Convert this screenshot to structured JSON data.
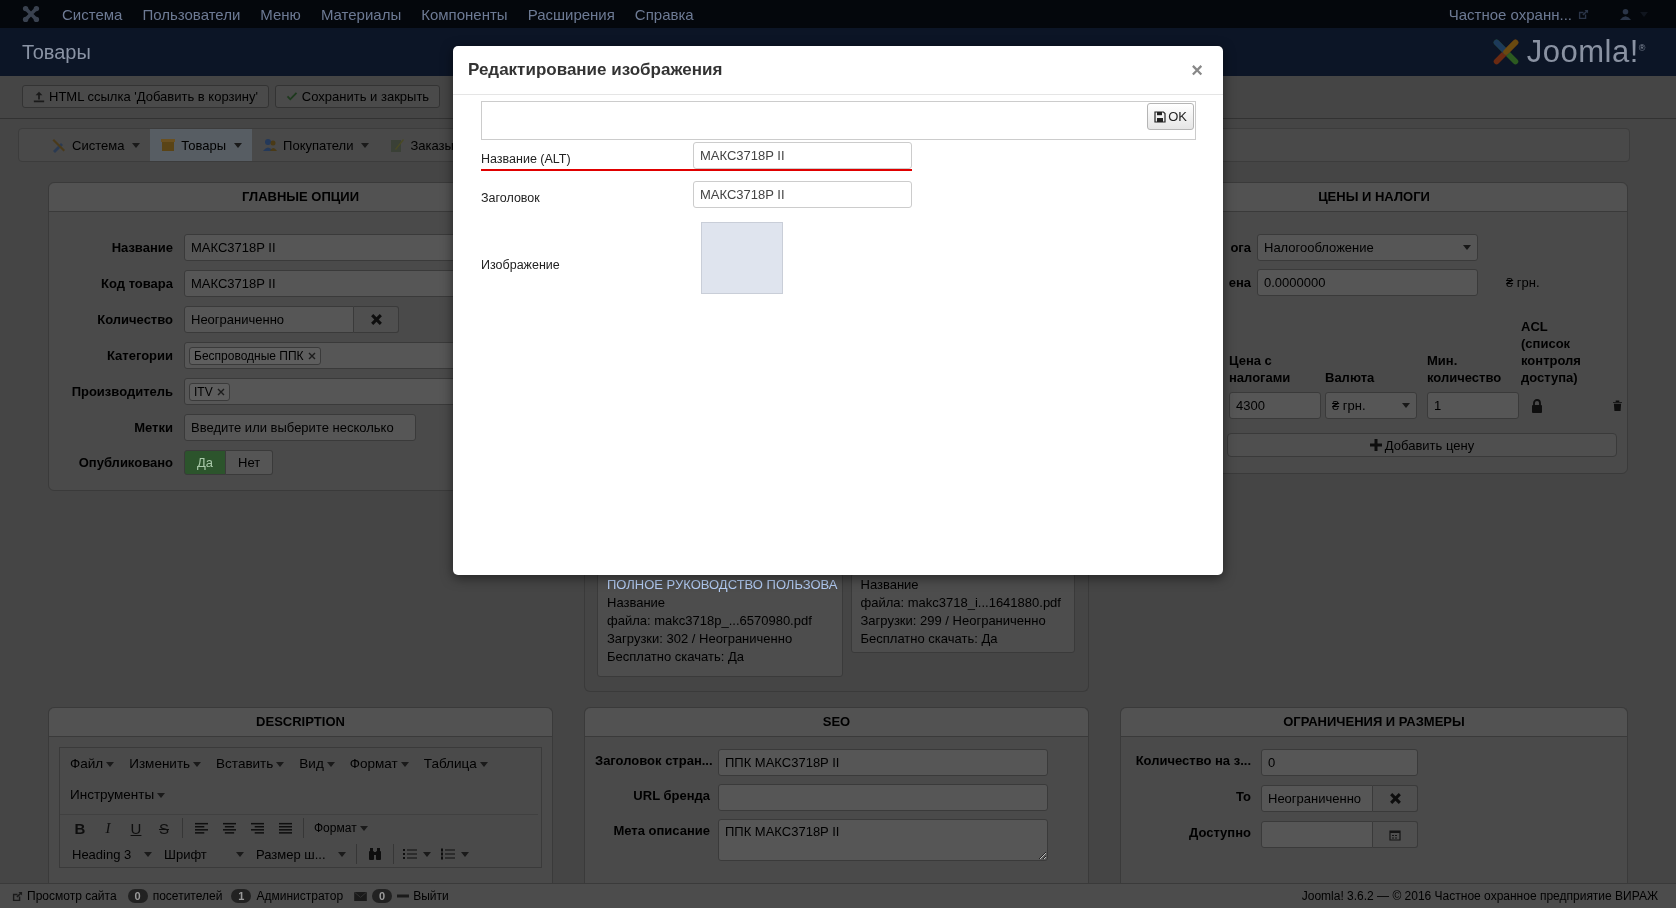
{
  "topbar": {
    "menu": [
      "Система",
      "Пользователи",
      "Меню",
      "Материалы",
      "Компоненты",
      "Расширения",
      "Справка"
    ],
    "site_link": "Частное охранн..."
  },
  "header": {
    "title": "Товары",
    "logo_text": "Joomla!$^{®}$"
  },
  "toolbar": {
    "buttons": [
      {
        "label": "HTML ссылка 'Добавить в корзину'"
      },
      {
        "label": "Сохранить и закрыть"
      }
    ]
  },
  "submenu": [
    {
      "label": "Система",
      "selected": false
    },
    {
      "label": "Товары",
      "selected": true
    },
    {
      "label": "Покупатели",
      "selected": false
    },
    {
      "label": "Заказы",
      "selected": false
    }
  ],
  "main_options": {
    "title": "ГЛАВНЫЕ ОПЦИИ",
    "fields": [
      {
        "label": "Название",
        "kind": "text",
        "value": "МАКС3718P II"
      },
      {
        "label": "Код товара",
        "kind": "text",
        "value": "МАКС3718P II"
      },
      {
        "label": "Количество",
        "kind": "clearable",
        "value": "Неограниченно"
      },
      {
        "label": "Категории",
        "kind": "tags",
        "tags": [
          "Беспроводные ППК"
        ]
      },
      {
        "label": "Производитель",
        "kind": "tags",
        "tags": [
          "ITV"
        ]
      },
      {
        "label": "Метки",
        "kind": "short",
        "placeholder": "Введите или выберите несколько"
      },
      {
        "label": "Опубликовано",
        "kind": "toggle",
        "options": [
          {
            "label": "Да",
            "selected": true
          },
          {
            "label": "Нет",
            "selected": false
          }
        ]
      }
    ]
  },
  "prices": {
    "title": "ЦЕНЫ И НАЛОГИ",
    "fields": [
      {
        "label": "ога",
        "kind": "select",
        "value": "Налогообложение"
      },
      {
        "label": "ена",
        "kind": "text",
        "value": "0.0000000",
        "suffix": "₴ грн."
      }
    ],
    "columns": [
      "Цена с налогами",
      "Валюта",
      "Мин. количество",
      "ACL (список контроля доступа)"
    ],
    "rows": [
      {
        "price": "4300",
        "currency": "₴ грн.",
        "min_qty": "1"
      }
    ],
    "add_button": "Добавить цену"
  },
  "files": [
    {
      "title": "ПОЛНОЕ РУКОВОДСТВО ПОЛЬЗОВА",
      "lines": [
        "Название",
        "файла: makc3718p_...6570980.pdf",
        "Загрузки: 302 / Неограниченно",
        "Бесплатно скачать: Да"
      ]
    },
    {
      "lines": [
        "Название",
        "файла: makc3718_i...1641880.pdf",
        "Загрузки: 299 / Неограниченно",
        "Бесплатно скачать: Да"
      ]
    }
  ],
  "description": {
    "title": "DESCRIPTION",
    "menus": [
      "Файл",
      "Изменить",
      "Вставить",
      "Вид",
      "Формат",
      "Таблица",
      "Инструменты"
    ],
    "format_buttons": [
      "B",
      "I",
      "U",
      "S"
    ],
    "format_menu": "Формат",
    "block_format": "Heading 3",
    "font": "Шрифт",
    "font_size": "Размер ш..."
  },
  "seo": {
    "title": "SEO",
    "fields": [
      {
        "label": "Заголовок стран...",
        "kind": "text",
        "value": "ППК МАКС3718P II"
      },
      {
        "label": "URL бренда",
        "kind": "text"
      },
      {
        "label": "Мета описание",
        "kind": "textarea",
        "value": "ППК МАКС3718P II"
      }
    ]
  },
  "limits": {
    "title": "ОГРАНИЧЕНИЯ И РАЗМЕРЫ",
    "fields": [
      {
        "label": "Количество на з...",
        "kind": "text",
        "value": "0"
      },
      {
        "label": "То",
        "kind": "clearable",
        "value": "Неограниченно"
      },
      {
        "label": "Доступно",
        "kind": "date"
      }
    ]
  },
  "status_bar": {
    "view_site": "Просмотр сайта",
    "visitors_count": "0",
    "visitors": "посетителей",
    "admins_count": "1",
    "admins": "Администратор",
    "messages_count": "0",
    "logout": "Выйти",
    "footer": "Joomla! 3.6.2 — © 2016 Частное охранное предприятие ВИРАЖ"
  },
  "modal": {
    "title": "Редактирование изображения",
    "close": "×",
    "ok": "OK",
    "fields": [
      {
        "label": "Название (ALT)",
        "kind": "text",
        "value": "МАКС3718P II",
        "highlighted": true
      },
      {
        "label": "Заголовок",
        "kind": "text",
        "value": "МАКС3718P II",
        "highlighted": false
      },
      {
        "label": "Изображение",
        "kind": "image",
        "highlighted": false
      }
    ]
  }
}
